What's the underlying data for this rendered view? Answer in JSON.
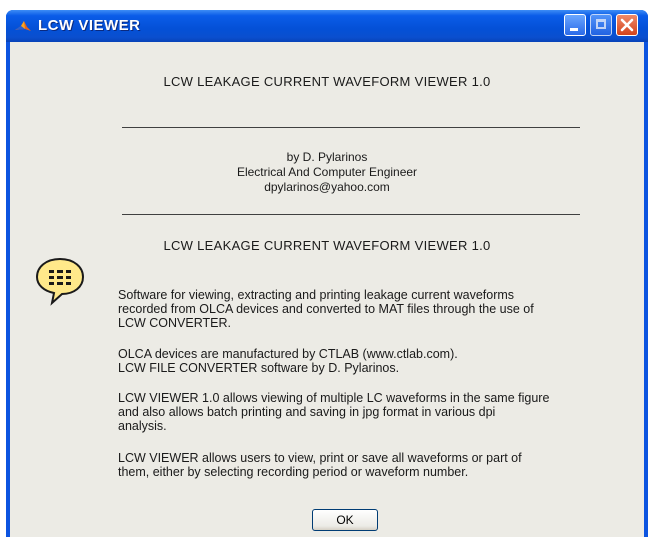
{
  "window": {
    "title": "LCW VIEWER"
  },
  "dialog": {
    "heading_top": "LCW LEAKAGE CURRENT WAVEFORM VIEWER 1.0",
    "author_lines": [
      "by  D. Pylarinos",
      "Electrical And Computer Engineer",
      "dpylarinos@yahoo.com"
    ],
    "heading_bottom": "LCW LEAKAGE CURRENT WAVEFORM VIEWER 1.0",
    "paragraphs": [
      [
        "Software for viewing, extracting and printing leakage current waveforms",
        "recorded from OLCA devices and converted to MAT files through the use of",
        "LCW CONVERTER."
      ],
      [
        "OLCA devices are manufactured by CTLAB (www.ctlab.com).",
        "LCW FILE CONVERTER  software  by D. Pylarinos."
      ],
      [
        "LCW VIEWER 1.0 allows viewing of multiple LC waveforms in the same figure",
        "and also allows batch printing and saving in jpg format in various dpi",
        "analysis."
      ],
      [
        "LCW VIEWER allows users to view, print or save all waveforms or part of",
        "them, either by selecting recording period or waveform number."
      ]
    ],
    "ok_label": "OK",
    "icon": "help-bubble-icon"
  },
  "colors": {
    "titlebar": "#0450d6",
    "client_bg": "#ecebe5",
    "bubble_fill": "#ffe98a"
  }
}
